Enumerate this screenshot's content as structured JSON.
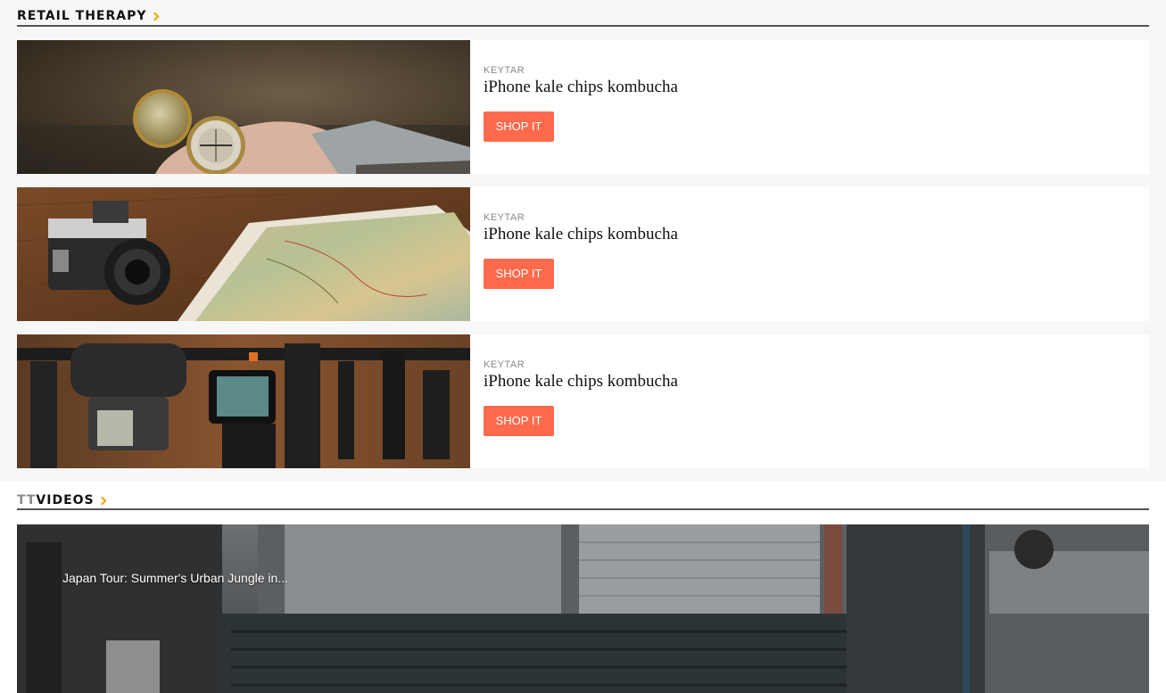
{
  "retail": {
    "title": "RETAIL THERAPY",
    "items": [
      {
        "category": "KEYTAR",
        "title": "iPhone kale chips kombucha",
        "button": "SHOP IT",
        "image": "compass-photo"
      },
      {
        "category": "KEYTAR",
        "title": "iPhone kale chips kombucha",
        "button": "SHOP IT",
        "image": "camera-map-photo"
      },
      {
        "category": "KEYTAR",
        "title": "iPhone kale chips kombucha",
        "button": "SHOP IT",
        "image": "camera-gear-photo"
      }
    ]
  },
  "videos": {
    "title_prefix": "TT",
    "title_rest": "VIDEOS",
    "featured": {
      "title": "Japan Tour: Summer's Urban Jungle in...",
      "image": "japan-street-photo"
    }
  },
  "colors": {
    "accent": "#f0a500",
    "button": "#ff6a4d"
  }
}
